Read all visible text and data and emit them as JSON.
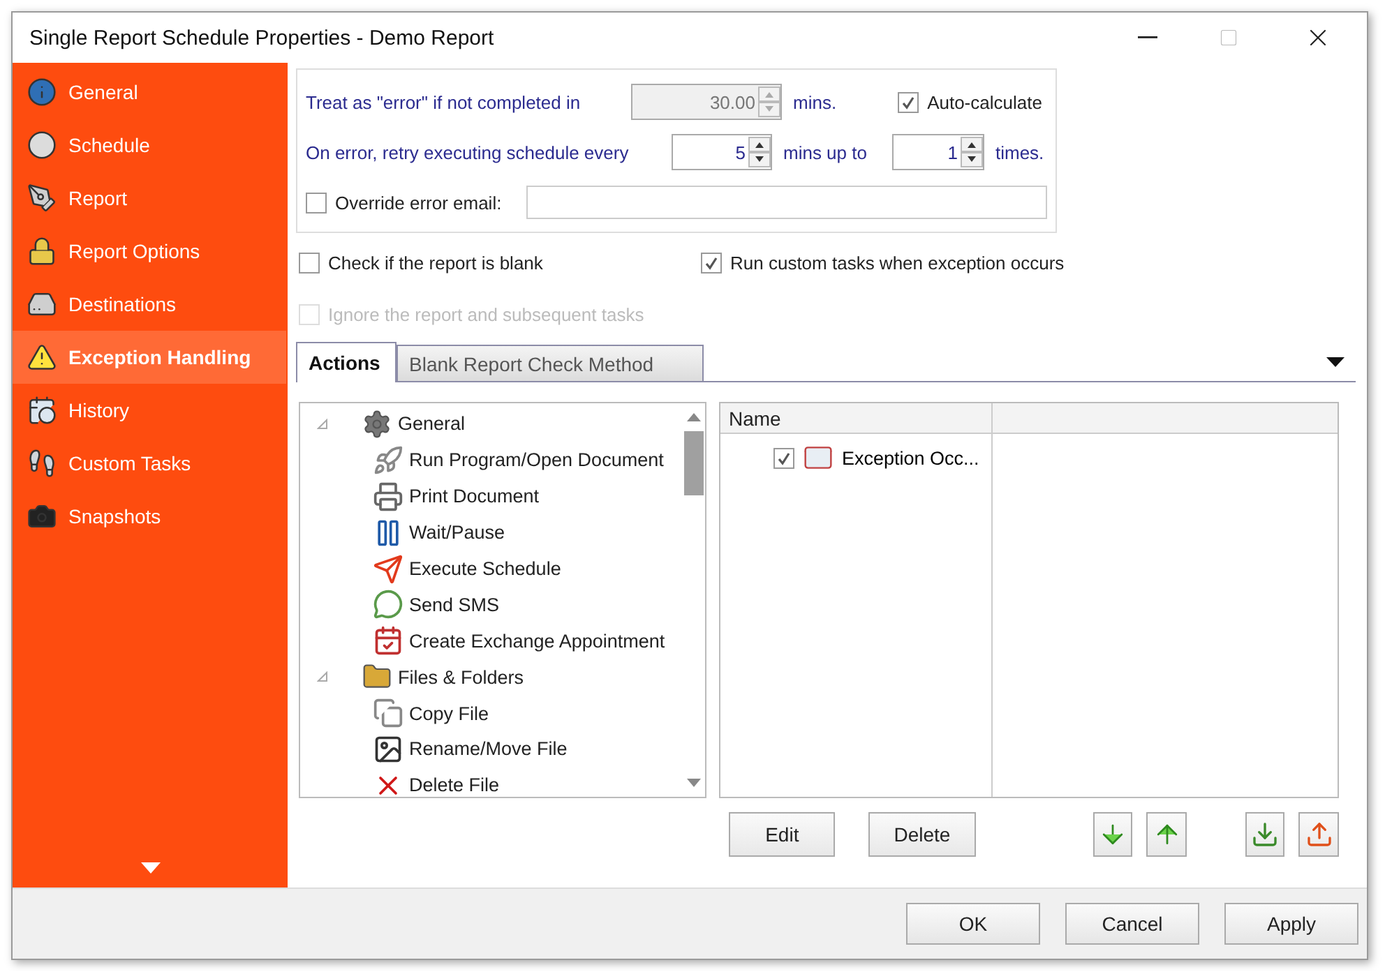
{
  "window": {
    "title": "Single Report Schedule Properties - Demo Report"
  },
  "sidebar": {
    "items": [
      {
        "label": "General",
        "selected": false
      },
      {
        "label": "Schedule",
        "selected": false
      },
      {
        "label": "Report",
        "selected": false
      },
      {
        "label": "Report Options",
        "selected": false
      },
      {
        "label": "Destinations",
        "selected": false
      },
      {
        "label": "Exception Handling",
        "selected": true
      },
      {
        "label": "History",
        "selected": false
      },
      {
        "label": "Custom Tasks",
        "selected": false
      },
      {
        "label": "Snapshots",
        "selected": false
      }
    ]
  },
  "error_settings": {
    "timeout_label": "Treat as \"error\" if not completed in",
    "timeout": {
      "value": "30.00",
      "disabled": true
    },
    "timeout_unit": "mins.",
    "auto_calculate": {
      "label": "Auto-calculate",
      "checked": true
    },
    "retry_label": "On error, retry  executing schedule every",
    "retry_interval": {
      "value": "5",
      "disabled": false
    },
    "retry_unit": "mins up to",
    "retry_count": {
      "value": "1",
      "disabled": false
    },
    "retry_count_unit": "times.",
    "override_email": {
      "label": "Override error email:",
      "checked": false
    }
  },
  "options": [
    {
      "label": "Check if the report is blank",
      "checked": false,
      "disabled": false
    },
    {
      "label": "Run custom tasks when exception occurs",
      "checked": true,
      "disabled": false
    },
    {
      "label": "Ignore the report and subsequent tasks",
      "checked": false,
      "disabled": true
    }
  ],
  "tabs": [
    {
      "label": "Actions",
      "selected": true
    },
    {
      "label": "Blank Report Check Method",
      "selected": false
    }
  ],
  "action_tree": [
    {
      "label": "General",
      "expanded": true,
      "children": [
        {
          "label": "Run Program/Open Document"
        },
        {
          "label": "Print Document"
        },
        {
          "label": "Wait/Pause"
        },
        {
          "label": "Execute Schedule"
        },
        {
          "label": "Send SMS"
        },
        {
          "label": "Create Exchange Appointment"
        }
      ]
    },
    {
      "label": "Files & Folders",
      "expanded": true,
      "children": [
        {
          "label": "Copy File"
        },
        {
          "label": "Rename/Move File"
        },
        {
          "label": "Delete File"
        }
      ]
    }
  ],
  "task_list": {
    "columns": [
      "Name"
    ],
    "rows": [
      {
        "name": "Exception Occ...",
        "checked": true
      }
    ]
  },
  "list_buttons": [
    "Edit",
    "Delete"
  ],
  "footer_buttons": [
    "OK",
    "Cancel",
    "Apply"
  ]
}
